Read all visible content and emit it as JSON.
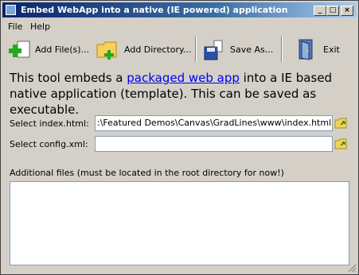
{
  "window": {
    "title": "Embed WebApp into a native (IE powered) application",
    "icon": "app-icon"
  },
  "title_buttons": {
    "minimize": "_",
    "maximize": "□",
    "close": "×"
  },
  "menu": [
    "File",
    "Help"
  ],
  "toolbar": {
    "add_files": "Add File(s)...",
    "add_directory": "Add Directory...",
    "save_as": "Save As...",
    "exit": "Exit"
  },
  "description": {
    "before": "This tool embeds a ",
    "link": "packaged web app",
    "after": " into a IE based native application (template). This can be saved as executable."
  },
  "fields": {
    "index_label": "Select index.html:",
    "index_value": ":\\Featured Demos\\Canvas\\GradLines\\www\\index.html\"",
    "config_label": "Select config.xml:",
    "config_value": ""
  },
  "files": {
    "label": "Additional files (must be located in the root directory for now!)"
  }
}
